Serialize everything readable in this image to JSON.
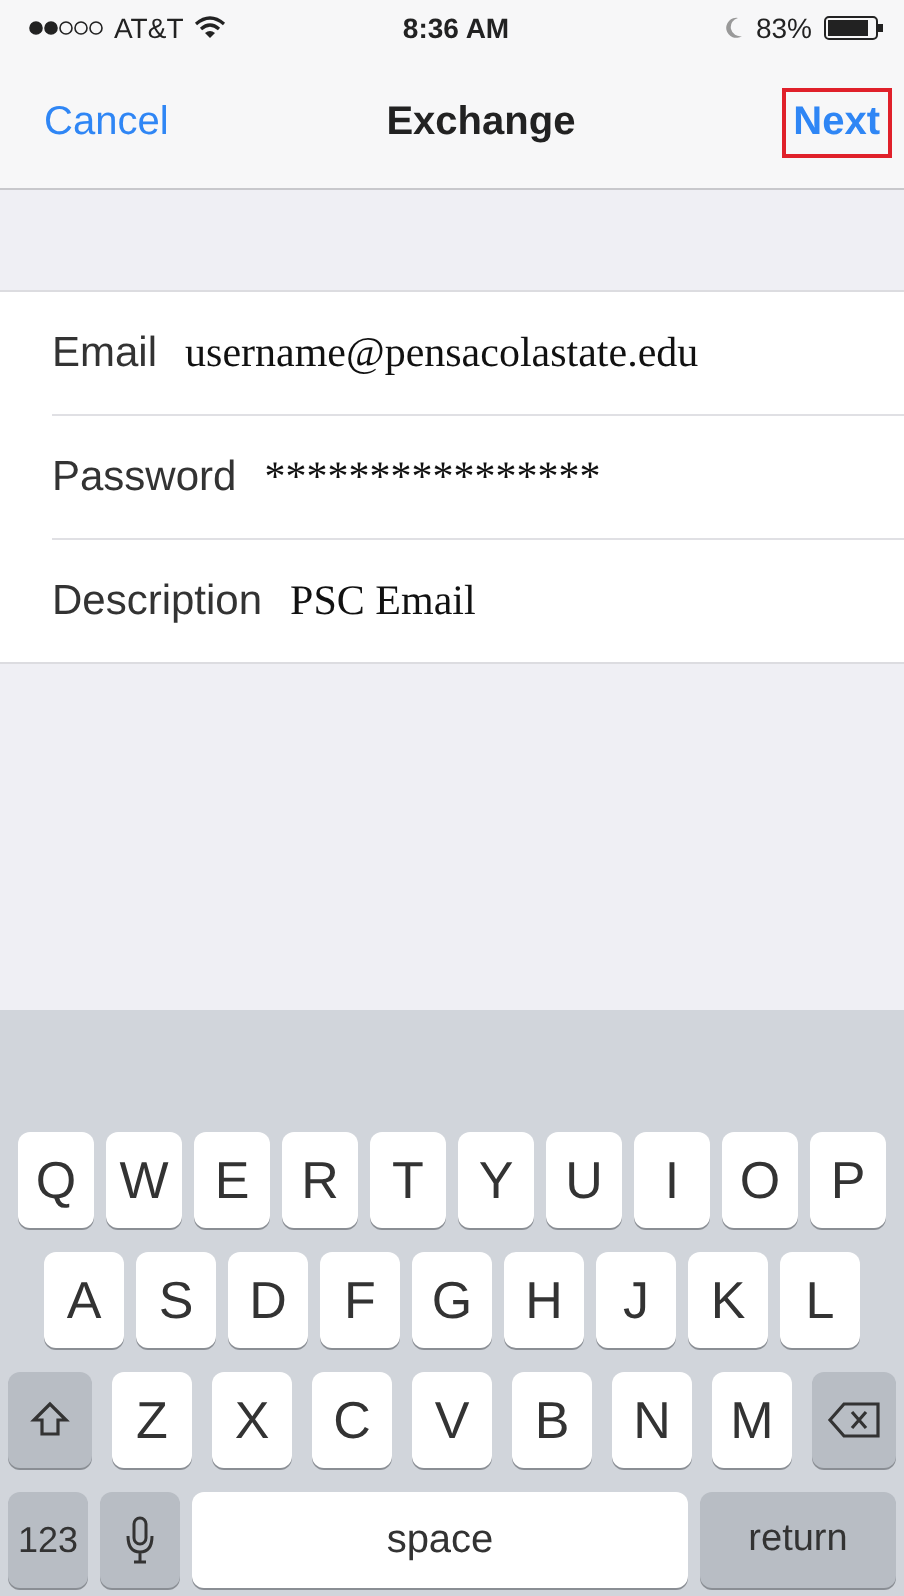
{
  "status_bar": {
    "carrier": "AT&T",
    "time": "8:36 AM",
    "battery": "83%"
  },
  "nav_bar": {
    "cancel": "Cancel",
    "title": "Exchange",
    "next": {
      "label": "Next",
      "highlighted": true
    }
  },
  "form": [
    {
      "label": "Email",
      "value": "username@pensacolastate.edu"
    },
    {
      "label": "Password",
      "value": "****************"
    },
    {
      "label": "Description",
      "value": "PSC Email"
    }
  ],
  "keyboard": [
    [
      {
        "kind": "letter",
        "label": "Q"
      },
      {
        "kind": "letter",
        "label": "W"
      },
      {
        "kind": "letter",
        "label": "E"
      },
      {
        "kind": "letter",
        "label": "R"
      },
      {
        "kind": "letter",
        "label": "T"
      },
      {
        "kind": "letter",
        "label": "Y"
      },
      {
        "kind": "letter",
        "label": "U"
      },
      {
        "kind": "letter",
        "label": "I"
      },
      {
        "kind": "letter",
        "label": "O"
      },
      {
        "kind": "letter",
        "label": "P"
      }
    ],
    [
      {
        "kind": "letter",
        "label": "A"
      },
      {
        "kind": "letter",
        "label": "S"
      },
      {
        "kind": "letter",
        "label": "D"
      },
      {
        "kind": "letter",
        "label": "F"
      },
      {
        "kind": "letter",
        "label": "G"
      },
      {
        "kind": "letter",
        "label": "H"
      },
      {
        "kind": "letter",
        "label": "J"
      },
      {
        "kind": "letter",
        "label": "K"
      },
      {
        "kind": "letter",
        "label": "L"
      }
    ],
    [
      {
        "kind": "shift"
      },
      {
        "kind": "letter",
        "label": "Z"
      },
      {
        "kind": "letter",
        "label": "X"
      },
      {
        "kind": "letter",
        "label": "C"
      },
      {
        "kind": "letter",
        "label": "V"
      },
      {
        "kind": "letter",
        "label": "B"
      },
      {
        "kind": "letter",
        "label": "N"
      },
      {
        "kind": "letter",
        "label": "M"
      },
      {
        "kind": "delete"
      }
    ],
    [
      {
        "kind": "numbers",
        "label": "123"
      },
      {
        "kind": "mic"
      },
      {
        "kind": "space",
        "label": "space"
      },
      {
        "kind": "return",
        "label": "return"
      }
    ]
  ]
}
